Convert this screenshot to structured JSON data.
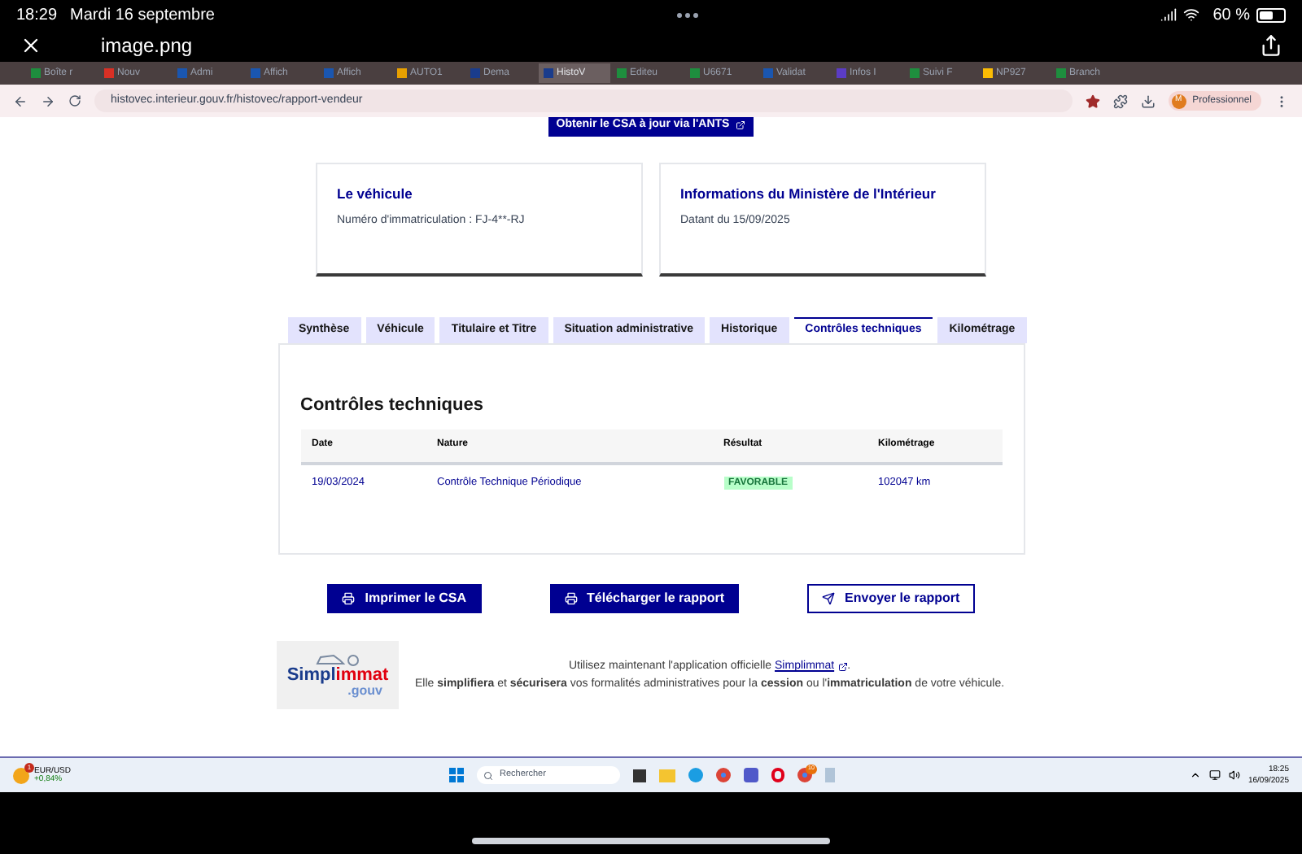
{
  "status_bar": {
    "time": "18:29",
    "date": "Mardi 16 septembre",
    "battery": "60 %"
  },
  "viewer": {
    "title": "image.png"
  },
  "browser": {
    "tabs": [
      {
        "label": "Boîte r",
        "selected": false,
        "color": "#1e8e3e"
      },
      {
        "label": "Nouv",
        "selected": false,
        "color": "#d93025"
      },
      {
        "label": "Admi",
        "selected": false,
        "color": "#1a56b0"
      },
      {
        "label": "Affich",
        "selected": false,
        "color": "#1a56b0"
      },
      {
        "label": "Affich",
        "selected": false,
        "color": "#1a56b0"
      },
      {
        "label": "AUTO1",
        "selected": false,
        "color": "#e8a000"
      },
      {
        "label": "Dema",
        "selected": false,
        "color": "#1a3c8c"
      },
      {
        "label": "HistoV",
        "selected": true,
        "color": "#1a3c8c"
      },
      {
        "label": "Editeu",
        "selected": false,
        "color": "#1e8e3e"
      },
      {
        "label": "U6671",
        "selected": false,
        "color": "#1e8e3e"
      },
      {
        "label": "Validat",
        "selected": false,
        "color": "#1a56b0"
      },
      {
        "label": "Infos I",
        "selected": false,
        "color": "#5b3cc4"
      },
      {
        "label": "Suivi F",
        "selected": false,
        "color": "#1e8e3e"
      },
      {
        "label": "NP927",
        "selected": false,
        "color": "#fbbc04"
      },
      {
        "label": "Branch",
        "selected": false,
        "color": "#1e8e3e"
      }
    ],
    "url": "histovec.interieur.gouv.fr/histovec/rapport-vendeur",
    "profile_initial": "M",
    "profile": "Professionnel"
  },
  "page": {
    "top_button": "Obtenir le CSA à jour via l'ANTS",
    "cards": [
      {
        "title": "Le véhicule",
        "text": "Numéro d'immatriculation : FJ-4**-RJ"
      },
      {
        "title": "Informations du Ministère de l'Intérieur",
        "text": "Datant du 15/09/2025"
      }
    ],
    "tabs": [
      {
        "label": "Synthèse",
        "selected": false
      },
      {
        "label": "Véhicule",
        "selected": false
      },
      {
        "label": "Titulaire et Titre",
        "selected": false
      },
      {
        "label": "Situation administrative",
        "selected": false
      },
      {
        "label": "Historique",
        "selected": false
      },
      {
        "label": "Contrôles techniques",
        "selected": true
      },
      {
        "label": "Kilométrage",
        "selected": false
      }
    ],
    "section_title": "Contrôles techniques",
    "table": {
      "columns": [
        "Date",
        "Nature",
        "Résultat",
        "Kilométrage"
      ],
      "rows": [
        {
          "date": "19/03/2024",
          "nature": "Contrôle Technique Périodique",
          "result": "FAVORABLE",
          "mileage": "102047 km"
        }
      ]
    },
    "actions": [
      {
        "label": "Imprimer le CSA",
        "kind": "primary"
      },
      {
        "label": "Télécharger le rapport",
        "kind": "primary"
      },
      {
        "label": "Envoyer le rapport",
        "kind": "secondary"
      }
    ],
    "promo": {
      "logo_main": "Simpl",
      "logo_accent": "immat",
      "logo_sub": ".gouv",
      "line1": "Utilisez maintenant l'application officielle",
      "link": "Simplimmat",
      "line1_end": ".",
      "line2": "Elle **simplifiera** et **sécurisera** vos formalités administratives pour la **cession** ou l'**immatriculation** de votre véhicule."
    }
  },
  "taskbar": {
    "widget_badge": "1",
    "widget_title": "EUR/USD",
    "widget_value": "+0,84%",
    "search_placeholder": "Rechercher",
    "app_badge": "10",
    "time": "18:25",
    "date": "16/09/2025"
  }
}
